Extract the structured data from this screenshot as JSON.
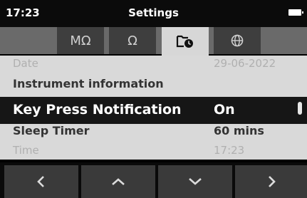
{
  "status": {
    "time": "17:23",
    "title": "Settings",
    "icons": {
      "battery": "battery-icon"
    }
  },
  "tabs": [
    {
      "label": "MΩ",
      "icon": "megohm-icon",
      "active": false
    },
    {
      "label": "Ω",
      "icon": "ohm-icon",
      "active": false
    },
    {
      "label": "",
      "icon": "settings-clock-icon",
      "active": true
    },
    {
      "label": "",
      "icon": "globe-icon",
      "active": false
    }
  ],
  "list": {
    "date": {
      "label": "Date",
      "value": "29-06-2022"
    },
    "instrument": {
      "label": "Instrument information"
    },
    "key_press": {
      "label": "Key Press Notification",
      "value": "On"
    },
    "sleep": {
      "label": "Sleep Timer",
      "value": "60 mins"
    },
    "time": {
      "label": "Time",
      "value": "17:23"
    }
  },
  "nav": [
    {
      "icon": "chevron-left-icon"
    },
    {
      "icon": "chevron-up-icon"
    },
    {
      "icon": "chevron-down-icon"
    },
    {
      "icon": "chevron-right-icon"
    }
  ],
  "colors": {
    "status_bg": "#0b0b0b",
    "tab_bg": "#6a6a6a",
    "tab_inactive": "#3e3e3e",
    "tab_active": "#d7d7d7",
    "content_bg": "#d9d9d9",
    "highlight_bg": "#161616",
    "nav_button": "#3a3a3a"
  }
}
